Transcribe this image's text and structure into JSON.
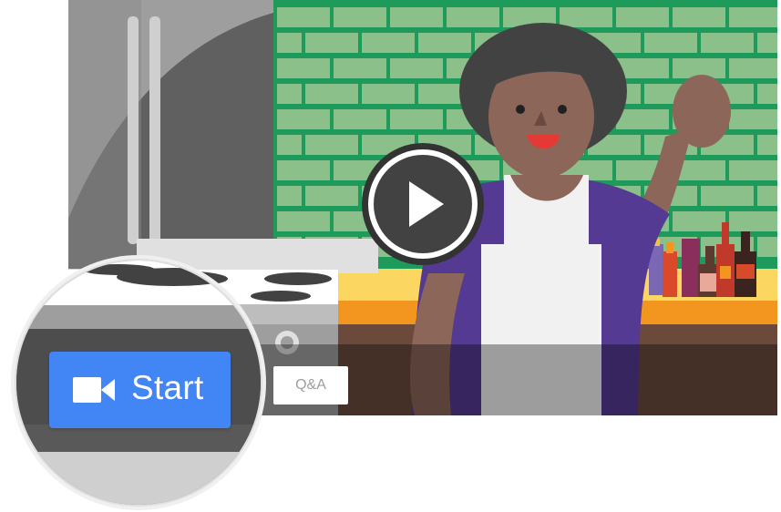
{
  "video": {
    "start_label": "Start",
    "qa_label": "Q&A",
    "icons": {
      "play": "play-icon",
      "camera": "video-camera-icon"
    }
  },
  "colors": {
    "start_button": "#4285f4",
    "brick_wall": "#8bc08a",
    "mortar": "#1e9a5a",
    "apron": "#f1f1f1",
    "shirt": "#553a93",
    "counter_top": "#fbd660",
    "counter_edge": "#f2961f"
  }
}
